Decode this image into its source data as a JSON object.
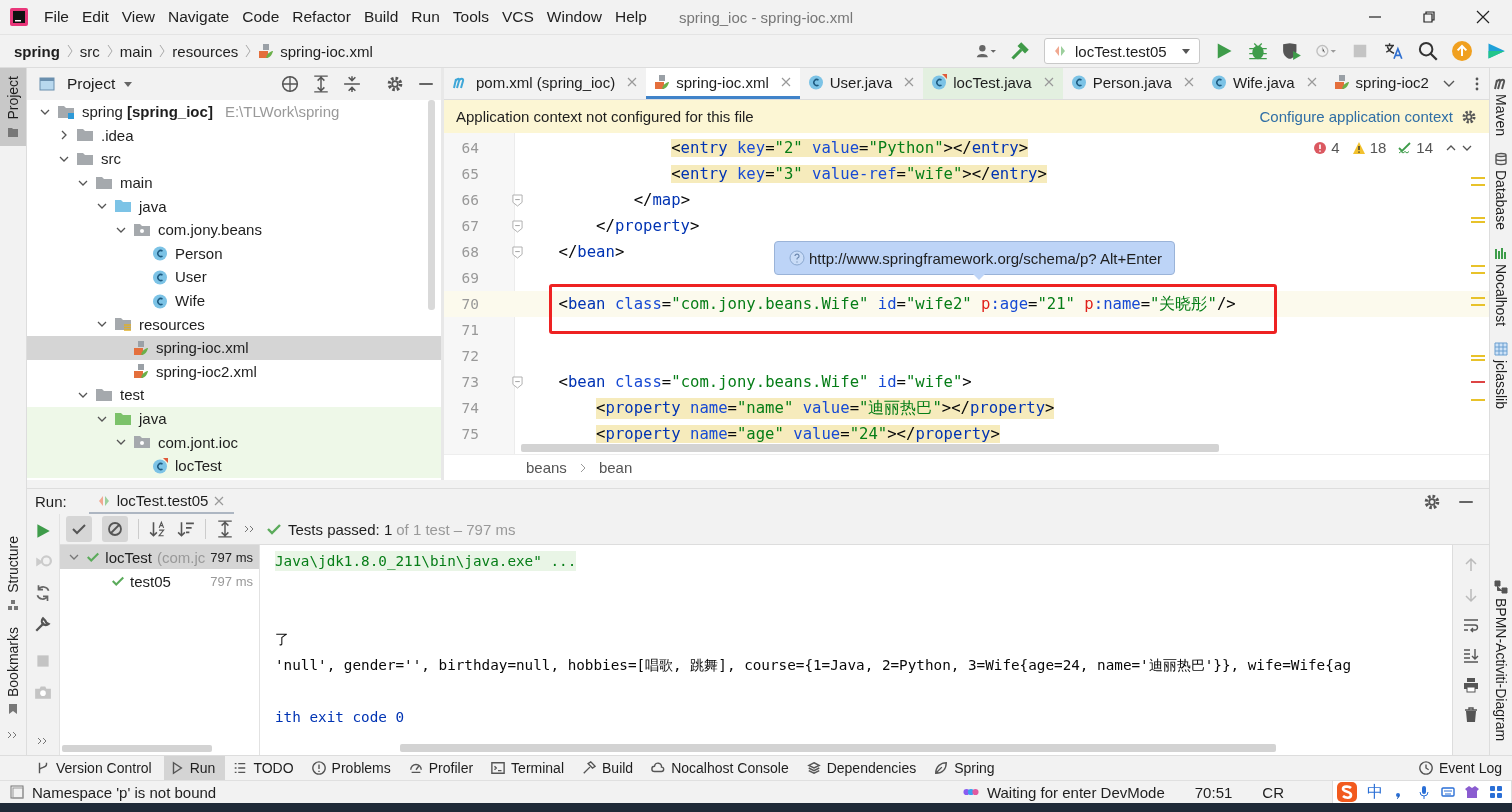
{
  "window": {
    "title": "spring_ioc - spring-ioc.xml"
  },
  "menu": [
    "File",
    "Edit",
    "View",
    "Navigate",
    "Code",
    "Refactor",
    "Build",
    "Run",
    "Tools",
    "VCS",
    "Window",
    "Help"
  ],
  "breadcrumb": [
    {
      "label": "spring",
      "bold": true
    },
    {
      "label": "src",
      "bold": false
    },
    {
      "label": "main",
      "bold": false
    },
    {
      "label": "resources",
      "bold": false
    },
    {
      "label": "spring-ioc.xml",
      "bold": false,
      "kind": "xml"
    }
  ],
  "run_config": {
    "label": "locTest.test05"
  },
  "left_stripe": [
    {
      "label": "Project",
      "selected": true,
      "kind": "project"
    },
    {
      "label": "Structure",
      "selected": false,
      "kind": "structure"
    },
    {
      "label": "Bookmarks",
      "selected": false,
      "kind": "bookmarks"
    }
  ],
  "right_stripe": [
    {
      "label": "Maven",
      "kind": "maven"
    },
    {
      "label": "Database",
      "kind": "database"
    },
    {
      "label": "Nocalhost",
      "kind": "nocalhost"
    },
    {
      "label": "jclasslib",
      "kind": "jclasslib"
    },
    {
      "label": "BPMN-Activiti-Diagram",
      "kind": "bpmn"
    }
  ],
  "project": {
    "title": "Project",
    "tree": [
      {
        "name": "spring **[spring_ioc]**",
        "path": "E:\\TLWork\\spring",
        "kind": "module",
        "expanded": true,
        "selected": false,
        "test_scope": false,
        "children": [
          {
            "name": ".idea",
            "kind": "folder",
            "expanded": false,
            "selected": false,
            "test_scope": false
          },
          {
            "name": "src",
            "kind": "folder",
            "expanded": true,
            "selected": false,
            "test_scope": false,
            "children": [
              {
                "name": "main",
                "kind": "folder",
                "expanded": true,
                "selected": false,
                "test_scope": false,
                "children": [
                  {
                    "name": "java",
                    "kind": "source",
                    "expanded": true,
                    "selected": false,
                    "test_scope": false,
                    "children": [
                      {
                        "name": "com.jony.beans",
                        "kind": "package",
                        "expanded": true,
                        "selected": false,
                        "test_scope": false,
                        "children": [
                          {
                            "name": "Person",
                            "kind": "class",
                            "selected": false,
                            "test_scope": false
                          },
                          {
                            "name": "User",
                            "kind": "class",
                            "selected": false,
                            "test_scope": false
                          },
                          {
                            "name": "Wife",
                            "kind": "class",
                            "selected": false,
                            "test_scope": false
                          }
                        ]
                      }
                    ]
                  },
                  {
                    "name": "resources",
                    "kind": "resources",
                    "expanded": true,
                    "selected": false,
                    "test_scope": false,
                    "children": [
                      {
                        "name": "spring-ioc.xml",
                        "kind": "xml",
                        "selected": true,
                        "test_scope": false
                      },
                      {
                        "name": "spring-ioc2.xml",
                        "kind": "xml",
                        "selected": false,
                        "test_scope": false
                      }
                    ]
                  }
                ]
              },
              {
                "name": "test",
                "kind": "folder",
                "expanded": true,
                "selected": false,
                "test_scope": false,
                "children": [
                  {
                    "name": "java",
                    "kind": "test-source",
                    "expanded": true,
                    "selected": false,
                    "test_scope": true,
                    "children": [
                      {
                        "name": "com.jont.ioc",
                        "kind": "package",
                        "expanded": true,
                        "selected": false,
                        "test_scope": true,
                        "children": [
                          {
                            "name": "locTest",
                            "kind": "test-class",
                            "selected": false,
                            "test_scope": true
                          }
                        ]
                      }
                    ]
                  }
                ]
              }
            ]
          }
        ]
      }
    ]
  },
  "editor": {
    "tabs": [
      {
        "label": "pom.xml (spring_ioc)",
        "kind": "maven",
        "selected": false,
        "closable": true,
        "test_scope": false
      },
      {
        "label": "spring-ioc.xml",
        "kind": "xml",
        "selected": true,
        "closable": true,
        "test_scope": false
      },
      {
        "label": "User.java",
        "kind": "class",
        "selected": false,
        "closable": true,
        "test_scope": false
      },
      {
        "label": "locTest.java",
        "kind": "test-class",
        "selected": false,
        "closable": true,
        "test_scope": true
      },
      {
        "label": "Person.java",
        "kind": "class",
        "selected": false,
        "closable": true,
        "test_scope": false
      },
      {
        "label": "Wife.java",
        "kind": "class",
        "selected": false,
        "closable": true,
        "test_scope": false
      },
      {
        "label": "spring-ioc2",
        "kind": "xml",
        "selected": false,
        "closable": false,
        "test_scope": false
      }
    ],
    "banner": {
      "text": "Application context not configured for this file",
      "link": "Configure application context"
    },
    "problems": {
      "errors": "4",
      "warnings": "18",
      "typos": "14"
    },
    "tooltip": "http://www.springframework.org/schema/p? Alt+Enter",
    "lines": [
      {
        "number": "64",
        "current": false,
        "annotated": false,
        "highlight": true,
        "fold": false,
        "tokens": [
          {
            "kind": "punct",
            "text": "                <"
          },
          {
            "kind": "tag",
            "text": "entry"
          },
          {
            "kind": "attr",
            "text": " key"
          },
          {
            "kind": "punct",
            "text": "="
          },
          {
            "kind": "value",
            "text": "\"2\""
          },
          {
            "kind": "attr",
            "text": " value"
          },
          {
            "kind": "punct",
            "text": "="
          },
          {
            "kind": "value",
            "text": "\"Python\""
          },
          {
            "kind": "punct",
            "text": "></"
          },
          {
            "kind": "tag",
            "text": "entry"
          },
          {
            "kind": "punct",
            "text": ">"
          }
        ]
      },
      {
        "number": "65",
        "current": false,
        "annotated": false,
        "highlight": true,
        "fold": false,
        "tokens": [
          {
            "kind": "punct",
            "text": "                <"
          },
          {
            "kind": "tag",
            "text": "entry"
          },
          {
            "kind": "attr",
            "text": " key"
          },
          {
            "kind": "punct",
            "text": "="
          },
          {
            "kind": "value",
            "text": "\"3\""
          },
          {
            "kind": "attr",
            "text": " value-ref"
          },
          {
            "kind": "punct",
            "text": "="
          },
          {
            "kind": "value",
            "text": "\"wife\""
          },
          {
            "kind": "punct",
            "text": "></"
          },
          {
            "kind": "tag",
            "text": "entry"
          },
          {
            "kind": "punct",
            "text": ">"
          }
        ]
      },
      {
        "number": "66",
        "current": false,
        "annotated": false,
        "highlight": false,
        "fold": true,
        "tokens": [
          {
            "kind": "punct",
            "text": "            </"
          },
          {
            "kind": "tag",
            "text": "map"
          },
          {
            "kind": "punct",
            "text": ">"
          }
        ]
      },
      {
        "number": "67",
        "current": false,
        "annotated": false,
        "highlight": false,
        "fold": true,
        "tokens": [
          {
            "kind": "punct",
            "text": "        </"
          },
          {
            "kind": "tag",
            "text": "property"
          },
          {
            "kind": "punct",
            "text": ">"
          }
        ]
      },
      {
        "number": "68",
        "current": false,
        "annotated": false,
        "highlight": false,
        "fold": true,
        "tokens": [
          {
            "kind": "punct",
            "text": "    </"
          },
          {
            "kind": "tag",
            "text": "bean"
          },
          {
            "kind": "punct",
            "text": ">"
          }
        ]
      },
      {
        "number": "69",
        "current": false,
        "annotated": false,
        "fold": false
      },
      {
        "number": "70",
        "current": true,
        "annotated": true,
        "highlight": false,
        "fold": false,
        "tokens": [
          {
            "kind": "punct",
            "text": "    <"
          },
          {
            "kind": "tag",
            "text": "bean"
          },
          {
            "kind": "attr",
            "text": " class"
          },
          {
            "kind": "punct",
            "text": "="
          },
          {
            "kind": "value",
            "text": "\"com.jony.beans.Wife\""
          },
          {
            "kind": "attr",
            "text": " id"
          },
          {
            "kind": "punct",
            "text": "="
          },
          {
            "kind": "value",
            "text": "\"wife2\" "
          },
          {
            "kind": "ns",
            "text": "p"
          },
          {
            "kind": "attr",
            "text": ":age"
          },
          {
            "kind": "punct",
            "text": "="
          },
          {
            "kind": "value",
            "text": "\"21\""
          },
          {
            "kind": "ns",
            "text": " p"
          },
          {
            "kind": "attr",
            "text": ":name"
          },
          {
            "kind": "punct",
            "text": "="
          },
          {
            "kind": "value",
            "text": "\"关晓彤\""
          },
          {
            "kind": "punct",
            "text": "/>"
          }
        ]
      },
      {
        "number": "71",
        "current": false,
        "annotated": false,
        "fold": false
      },
      {
        "number": "72",
        "current": false,
        "annotated": false,
        "fold": false
      },
      {
        "number": "73",
        "current": false,
        "annotated": false,
        "highlight": false,
        "fold": true,
        "tokens": [
          {
            "kind": "punct",
            "text": "    <"
          },
          {
            "kind": "tag",
            "text": "bean"
          },
          {
            "kind": "attr",
            "text": " class"
          },
          {
            "kind": "punct",
            "text": "="
          },
          {
            "kind": "value",
            "text": "\"com.jony.beans.Wife\""
          },
          {
            "kind": "attr",
            "text": " id"
          },
          {
            "kind": "punct",
            "text": "="
          },
          {
            "kind": "value",
            "text": "\"wife\""
          },
          {
            "kind": "punct",
            "text": ">"
          }
        ]
      },
      {
        "number": "74",
        "current": false,
        "annotated": false,
        "highlight": true,
        "fold": false,
        "tokens": [
          {
            "kind": "punct",
            "text": "        <"
          },
          {
            "kind": "tag",
            "text": "property"
          },
          {
            "kind": "attr",
            "text": " name"
          },
          {
            "kind": "punct",
            "text": "="
          },
          {
            "kind": "value",
            "text": "\"name\""
          },
          {
            "kind": "attr",
            "text": " value"
          },
          {
            "kind": "punct",
            "text": "="
          },
          {
            "kind": "value",
            "text": "\"迪丽热巴\""
          },
          {
            "kind": "punct",
            "text": "></"
          },
          {
            "kind": "tag",
            "text": "property"
          },
          {
            "kind": "punct",
            "text": ">"
          }
        ]
      },
      {
        "number": "75",
        "current": false,
        "annotated": false,
        "highlight": true,
        "fold": false,
        "tokens": [
          {
            "kind": "punct",
            "text": "        <"
          },
          {
            "kind": "tag",
            "text": "property"
          },
          {
            "kind": "attr",
            "text": " name"
          },
          {
            "kind": "punct",
            "text": "="
          },
          {
            "kind": "value",
            "text": "\"age\""
          },
          {
            "kind": "attr",
            "text": " value"
          },
          {
            "kind": "punct",
            "text": "="
          },
          {
            "kind": "value",
            "text": "\"24\""
          },
          {
            "kind": "punct",
            "text": "></"
          },
          {
            "kind": "tag",
            "text": "property"
          },
          {
            "kind": "punct",
            "text": ">"
          }
        ]
      }
    ],
    "path": [
      "beans",
      "bean"
    ]
  },
  "run": {
    "label": "Run:",
    "tab": "locTest.test05",
    "toggles": [
      {
        "kind": "passed",
        "selected": true
      },
      {
        "kind": "ignored",
        "selected": true
      }
    ],
    "status": "Tests passed: 1",
    "detail": "of 1 test – 797 ms",
    "tests": [
      {
        "name": "locTest",
        "package": "(com.jc",
        "time": "797 ms",
        "selected": true,
        "expanded": true,
        "children": [
          {
            "name": "test05",
            "time": "797 ms",
            "selected": false
          }
        ]
      }
    ],
    "console": [
      {
        "kind": "command",
        "text": "Java\\jdk1.8.0_211\\bin\\java.exe\" ..."
      },
      {
        "kind": "blank"
      },
      {
        "kind": "blank"
      },
      {
        "kind": "output",
        "text": "了"
      },
      {
        "kind": "output",
        "text": "'null', gender='', birthday=null, hobbies=[唱歌, 跳舞], course={1=Java, 2=Python, 3=Wife{age=24, name='迪丽热巴'}}, wife=Wife{ag"
      },
      {
        "kind": "blank"
      },
      {
        "kind": "exit",
        "text": "ith exit code 0"
      }
    ]
  },
  "tool_windows": [
    {
      "label": "Version Control",
      "kind": "vcs",
      "selected": false
    },
    {
      "label": "Run",
      "kind": "run",
      "selected": true
    },
    {
      "label": "TODO",
      "kind": "todo",
      "selected": false
    },
    {
      "label": "Problems",
      "kind": "problems",
      "selected": false
    },
    {
      "label": "Profiler",
      "kind": "profiler",
      "selected": false
    },
    {
      "label": "Terminal",
      "kind": "terminal",
      "selected": false
    },
    {
      "label": "Build",
      "kind": "build",
      "selected": false
    },
    {
      "label": "Nocalhost Console",
      "kind": "nocalhost",
      "selected": false
    },
    {
      "label": "Dependencies",
      "kind": "dependencies",
      "selected": false
    },
    {
      "label": "Spring",
      "kind": "spring",
      "selected": false
    },
    {
      "label": "Event Log",
      "kind": "log",
      "selected": false
    }
  ],
  "status_bar": {
    "message": "Namespace 'p' is not bound",
    "devmode": "Waiting for enter DevMode",
    "position": "70:51",
    "line_separator": "CR",
    "ime": "中"
  }
}
